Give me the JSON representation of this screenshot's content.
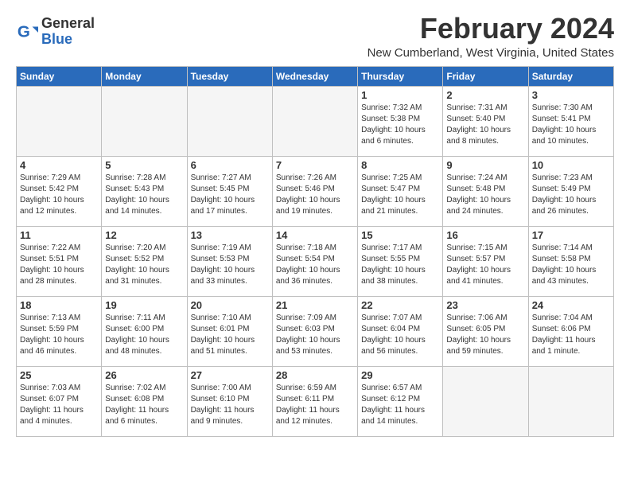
{
  "header": {
    "logo_general": "General",
    "logo_blue": "Blue",
    "month_title": "February 2024",
    "location": "New Cumberland, West Virginia, United States"
  },
  "weekdays": [
    "Sunday",
    "Monday",
    "Tuesday",
    "Wednesday",
    "Thursday",
    "Friday",
    "Saturday"
  ],
  "weeks": [
    [
      {
        "day": "",
        "info": ""
      },
      {
        "day": "",
        "info": ""
      },
      {
        "day": "",
        "info": ""
      },
      {
        "day": "",
        "info": ""
      },
      {
        "day": "1",
        "info": "Sunrise: 7:32 AM\nSunset: 5:38 PM\nDaylight: 10 hours\nand 6 minutes."
      },
      {
        "day": "2",
        "info": "Sunrise: 7:31 AM\nSunset: 5:40 PM\nDaylight: 10 hours\nand 8 minutes."
      },
      {
        "day": "3",
        "info": "Sunrise: 7:30 AM\nSunset: 5:41 PM\nDaylight: 10 hours\nand 10 minutes."
      }
    ],
    [
      {
        "day": "4",
        "info": "Sunrise: 7:29 AM\nSunset: 5:42 PM\nDaylight: 10 hours\nand 12 minutes."
      },
      {
        "day": "5",
        "info": "Sunrise: 7:28 AM\nSunset: 5:43 PM\nDaylight: 10 hours\nand 14 minutes."
      },
      {
        "day": "6",
        "info": "Sunrise: 7:27 AM\nSunset: 5:45 PM\nDaylight: 10 hours\nand 17 minutes."
      },
      {
        "day": "7",
        "info": "Sunrise: 7:26 AM\nSunset: 5:46 PM\nDaylight: 10 hours\nand 19 minutes."
      },
      {
        "day": "8",
        "info": "Sunrise: 7:25 AM\nSunset: 5:47 PM\nDaylight: 10 hours\nand 21 minutes."
      },
      {
        "day": "9",
        "info": "Sunrise: 7:24 AM\nSunset: 5:48 PM\nDaylight: 10 hours\nand 24 minutes."
      },
      {
        "day": "10",
        "info": "Sunrise: 7:23 AM\nSunset: 5:49 PM\nDaylight: 10 hours\nand 26 minutes."
      }
    ],
    [
      {
        "day": "11",
        "info": "Sunrise: 7:22 AM\nSunset: 5:51 PM\nDaylight: 10 hours\nand 28 minutes."
      },
      {
        "day": "12",
        "info": "Sunrise: 7:20 AM\nSunset: 5:52 PM\nDaylight: 10 hours\nand 31 minutes."
      },
      {
        "day": "13",
        "info": "Sunrise: 7:19 AM\nSunset: 5:53 PM\nDaylight: 10 hours\nand 33 minutes."
      },
      {
        "day": "14",
        "info": "Sunrise: 7:18 AM\nSunset: 5:54 PM\nDaylight: 10 hours\nand 36 minutes."
      },
      {
        "day": "15",
        "info": "Sunrise: 7:17 AM\nSunset: 5:55 PM\nDaylight: 10 hours\nand 38 minutes."
      },
      {
        "day": "16",
        "info": "Sunrise: 7:15 AM\nSunset: 5:57 PM\nDaylight: 10 hours\nand 41 minutes."
      },
      {
        "day": "17",
        "info": "Sunrise: 7:14 AM\nSunset: 5:58 PM\nDaylight: 10 hours\nand 43 minutes."
      }
    ],
    [
      {
        "day": "18",
        "info": "Sunrise: 7:13 AM\nSunset: 5:59 PM\nDaylight: 10 hours\nand 46 minutes."
      },
      {
        "day": "19",
        "info": "Sunrise: 7:11 AM\nSunset: 6:00 PM\nDaylight: 10 hours\nand 48 minutes."
      },
      {
        "day": "20",
        "info": "Sunrise: 7:10 AM\nSunset: 6:01 PM\nDaylight: 10 hours\nand 51 minutes."
      },
      {
        "day": "21",
        "info": "Sunrise: 7:09 AM\nSunset: 6:03 PM\nDaylight: 10 hours\nand 53 minutes."
      },
      {
        "day": "22",
        "info": "Sunrise: 7:07 AM\nSunset: 6:04 PM\nDaylight: 10 hours\nand 56 minutes."
      },
      {
        "day": "23",
        "info": "Sunrise: 7:06 AM\nSunset: 6:05 PM\nDaylight: 10 hours\nand 59 minutes."
      },
      {
        "day": "24",
        "info": "Sunrise: 7:04 AM\nSunset: 6:06 PM\nDaylight: 11 hours\nand 1 minute."
      }
    ],
    [
      {
        "day": "25",
        "info": "Sunrise: 7:03 AM\nSunset: 6:07 PM\nDaylight: 11 hours\nand 4 minutes."
      },
      {
        "day": "26",
        "info": "Sunrise: 7:02 AM\nSunset: 6:08 PM\nDaylight: 11 hours\nand 6 minutes."
      },
      {
        "day": "27",
        "info": "Sunrise: 7:00 AM\nSunset: 6:10 PM\nDaylight: 11 hours\nand 9 minutes."
      },
      {
        "day": "28",
        "info": "Sunrise: 6:59 AM\nSunset: 6:11 PM\nDaylight: 11 hours\nand 12 minutes."
      },
      {
        "day": "29",
        "info": "Sunrise: 6:57 AM\nSunset: 6:12 PM\nDaylight: 11 hours\nand 14 minutes."
      },
      {
        "day": "",
        "info": ""
      },
      {
        "day": "",
        "info": ""
      }
    ]
  ]
}
